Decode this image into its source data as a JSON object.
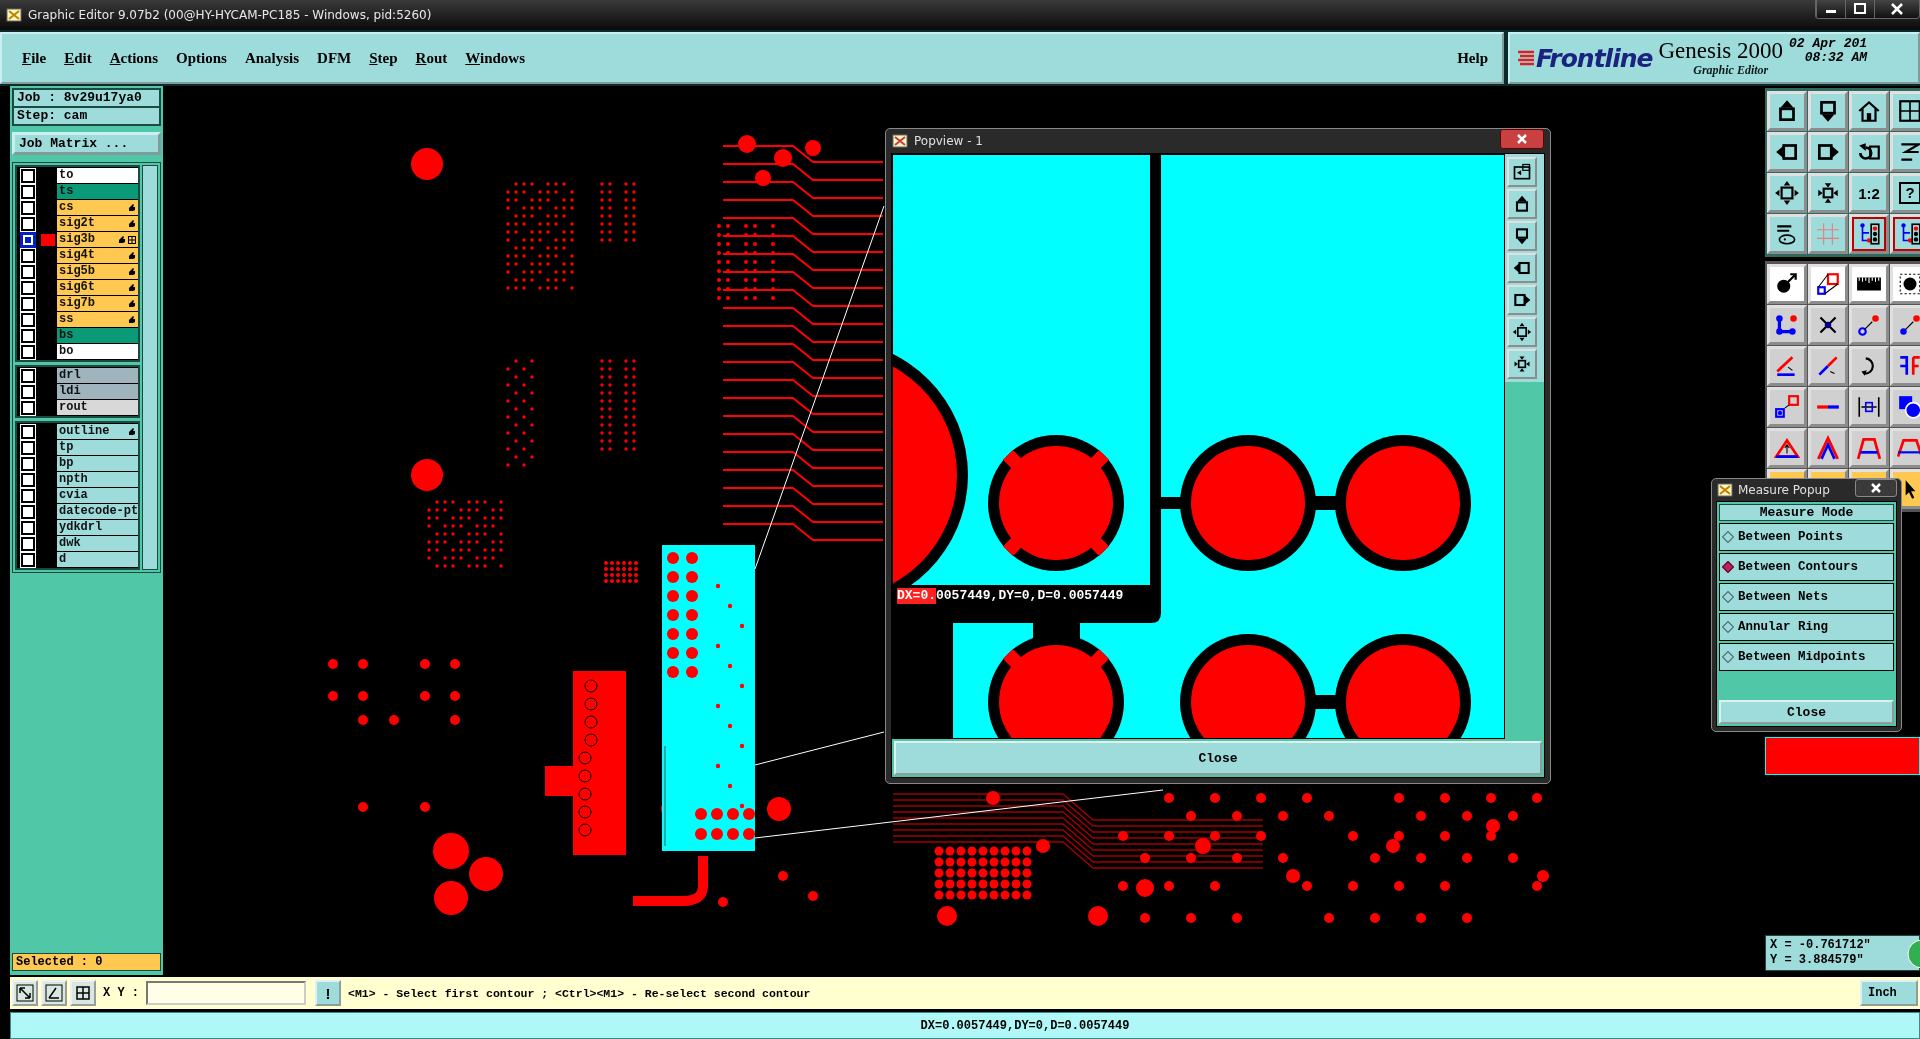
{
  "window": {
    "title": "Graphic Editor 9.07b2 (00@HY-HYCAM-PC185 - Windows, pid:5260)"
  },
  "menu": [
    {
      "label": "File",
      "mnemonic": true
    },
    {
      "label": "Edit",
      "mnemonic": true
    },
    {
      "label": "Actions",
      "mnemonic": true
    },
    {
      "label": "Options",
      "mnemonic": false
    },
    {
      "label": "Analysis",
      "mnemonic": false
    },
    {
      "label": "DFM",
      "mnemonic": false
    },
    {
      "label": "Step",
      "mnemonic": true
    },
    {
      "label": "Rout",
      "mnemonic": true
    },
    {
      "label": "Windows",
      "mnemonic": true
    }
  ],
  "help": "Help",
  "brand": {
    "logo": "Frontline",
    "product": "Genesis 2000",
    "subtitle": "Graphic Editor",
    "date": "02 Apr 201",
    "time": "08:32 AM"
  },
  "job_panel": {
    "job": "Job : 8v29u17ya0",
    "step": "Step: cam",
    "matrix_button": "Job Matrix ...",
    "layer_groups": [
      {
        "layers": [
          {
            "name": "to",
            "color": "#ffffff",
            "affected": false,
            "selected": false,
            "work_layer": false
          },
          {
            "name": "ts",
            "color": "#0a9a78",
            "affected": false,
            "selected": false,
            "work_layer": false
          },
          {
            "name": "cs",
            "color": "#ffc850",
            "affected": true,
            "selected": false,
            "work_layer": false
          },
          {
            "name": "sig2t",
            "color": "#ffc850",
            "affected": true,
            "selected": false,
            "work_layer": false
          },
          {
            "name": "sig3b",
            "color": "#ffc850",
            "affected": true,
            "selected": true,
            "work_layer": true
          },
          {
            "name": "sig4t",
            "color": "#ffc850",
            "affected": true,
            "selected": false,
            "work_layer": false
          },
          {
            "name": "sig5b",
            "color": "#ffc850",
            "affected": true,
            "selected": false,
            "work_layer": false
          },
          {
            "name": "sig6t",
            "color": "#ffc850",
            "affected": true,
            "selected": false,
            "work_layer": false
          },
          {
            "name": "sig7b",
            "color": "#ffc850",
            "affected": true,
            "selected": false,
            "work_layer": false
          },
          {
            "name": "ss",
            "color": "#ffc850",
            "affected": true,
            "selected": false,
            "work_layer": false
          },
          {
            "name": "bs",
            "color": "#0a9a78",
            "affected": false,
            "selected": false,
            "work_layer": false
          },
          {
            "name": "bo",
            "color": "#ffffff",
            "affected": false,
            "selected": false,
            "work_layer": false
          }
        ]
      },
      {
        "layers": [
          {
            "name": "drl",
            "color": "#9fb4bc",
            "affected": false,
            "selected": false,
            "work_layer": false
          },
          {
            "name": "ldi",
            "color": "#9fb4bc",
            "affected": false,
            "selected": false,
            "work_layer": false
          },
          {
            "name": "rout",
            "color": "#d8d8d8",
            "affected": false,
            "selected": false,
            "work_layer": false
          }
        ]
      },
      {
        "layers": [
          {
            "name": "outline",
            "color": "#9edcdc",
            "affected": true,
            "selected": false,
            "work_layer": false
          },
          {
            "name": "tp",
            "color": "#9edcdc",
            "affected": false,
            "selected": false,
            "work_layer": false
          },
          {
            "name": "bp",
            "color": "#9edcdc",
            "affected": false,
            "selected": false,
            "work_layer": false
          },
          {
            "name": "npth",
            "color": "#9edcdc",
            "affected": false,
            "selected": false,
            "work_layer": false
          },
          {
            "name": "cvia",
            "color": "#9edcdc",
            "affected": false,
            "selected": false,
            "work_layer": false
          },
          {
            "name": "datecode-pt",
            "color": "#9edcdc",
            "affected": false,
            "selected": false,
            "work_layer": false
          },
          {
            "name": "ydkdrl",
            "color": "#9edcdc",
            "affected": false,
            "selected": false,
            "work_layer": false
          },
          {
            "name": "dwk",
            "color": "#9edcdc",
            "affected": false,
            "selected": false,
            "work_layer": false
          },
          {
            "name": "d",
            "color": "#9edcdc",
            "affected": false,
            "selected": false,
            "work_layer": false
          }
        ]
      }
    ],
    "selected_count": "Selected : 0"
  },
  "popview": {
    "title": "Popview - 1",
    "measure_label": "DX=0.0057449,DY=0,D=0.0057449",
    "close": "Close"
  },
  "toolbar_text": {
    "scale": "1:2",
    "help": "?"
  },
  "measure_popup": {
    "title": "Measure Popup",
    "heading": "Measure Mode",
    "options": [
      {
        "label": "Between Points",
        "selected": false
      },
      {
        "label": "Between Contours",
        "selected": true
      },
      {
        "label": "Between Nets",
        "selected": false
      },
      {
        "label": "Annular Ring",
        "selected": false
      },
      {
        "label": "Between Midpoints",
        "selected": false
      }
    ],
    "close": "Close"
  },
  "coordinates": {
    "x": "X = -0.761712\"",
    "y": "Y = 3.884579\""
  },
  "command_bar": {
    "xy_label": "X Y :",
    "alert": "!",
    "message": "<M1> - Select first contour ; <Ctrl><M1> - Re-select second contour",
    "units": "Inch"
  },
  "status_bar": "DX=0.0057449,DY=0,D=0.0057449"
}
